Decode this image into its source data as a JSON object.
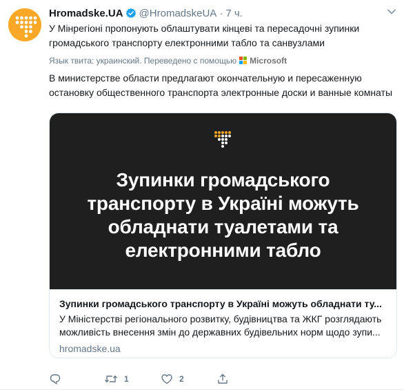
{
  "colors": {
    "brand_orange": "#f8a826",
    "link_blue": "#1da1f2",
    "text": "#14171a",
    "muted": "#657786",
    "card_image_bg": "#1f1f1f"
  },
  "tweet": {
    "author_name": "Hromadske.UA",
    "verified_icon": "verified-badge-icon",
    "handle": "@HromadskeUA",
    "separator": "·",
    "time": "7 ч.",
    "text_line1": "У Мінрегіоні пропонують облаштувати кінцеві та пересадочні зупинки",
    "text_line2": "громадського транспорту електронними табло та санвузлами",
    "translated_by": "Язык твита: украинский. Переведено с помощью",
    "translator_brand": "Microsoft",
    "translation_line1": "В министерстве области предлагают окончательную и пересаженную",
    "translation_line2": "остановку общественного транспорта электронные доски и ванные комнаты"
  },
  "card": {
    "image_headline_line1": "Зупинки громадського",
    "image_headline_line2": "транспорту в Україні можуть",
    "image_headline_line3": "обладнати туалетами та",
    "image_headline_line4": "електронними табло",
    "title": "Зупинки громадського транспорту в Україні можуть обладнати ту...",
    "description_line1": "У Міністерстві регіонального розвитку, будівництва та ЖКГ розглядають",
    "description_line2": "можливість внесення змін до державних будівельних норм щодо зупи...",
    "domain": "hromadske.ua"
  },
  "actions": {
    "reply_icon": "reply-icon",
    "retweet_icon": "retweet-icon",
    "retweet_count": "1",
    "like_icon": "heart-icon",
    "like_count": "2",
    "share_icon": "share-icon"
  }
}
